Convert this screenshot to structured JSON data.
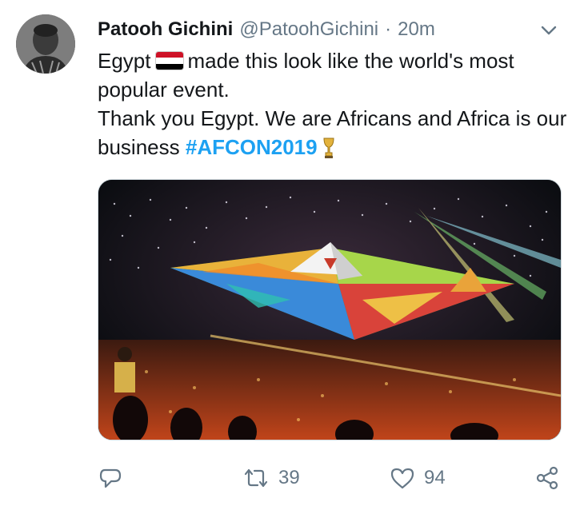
{
  "tweet": {
    "author_name": "Patooh Gichini",
    "handle": "@PatoohGichini",
    "separator": "·",
    "time": "20m",
    "text_part1": "Egypt",
    "text_part2": "made this look like the world's most popular event.",
    "text_part3": "Thank you Egypt. We are Africans and Africa is our business",
    "hashtag": "#AFCON2019",
    "flag_colors": [
      "#ce1126",
      "#ffffff",
      "#000000"
    ],
    "hashtag_color": "#1da1f2",
    "media": {
      "description_icon": "stadium-photo"
    }
  },
  "actions": {
    "reply_icon": "reply-icon",
    "retweet_count": "39",
    "like_count": "94",
    "share_icon": "share-icon"
  }
}
